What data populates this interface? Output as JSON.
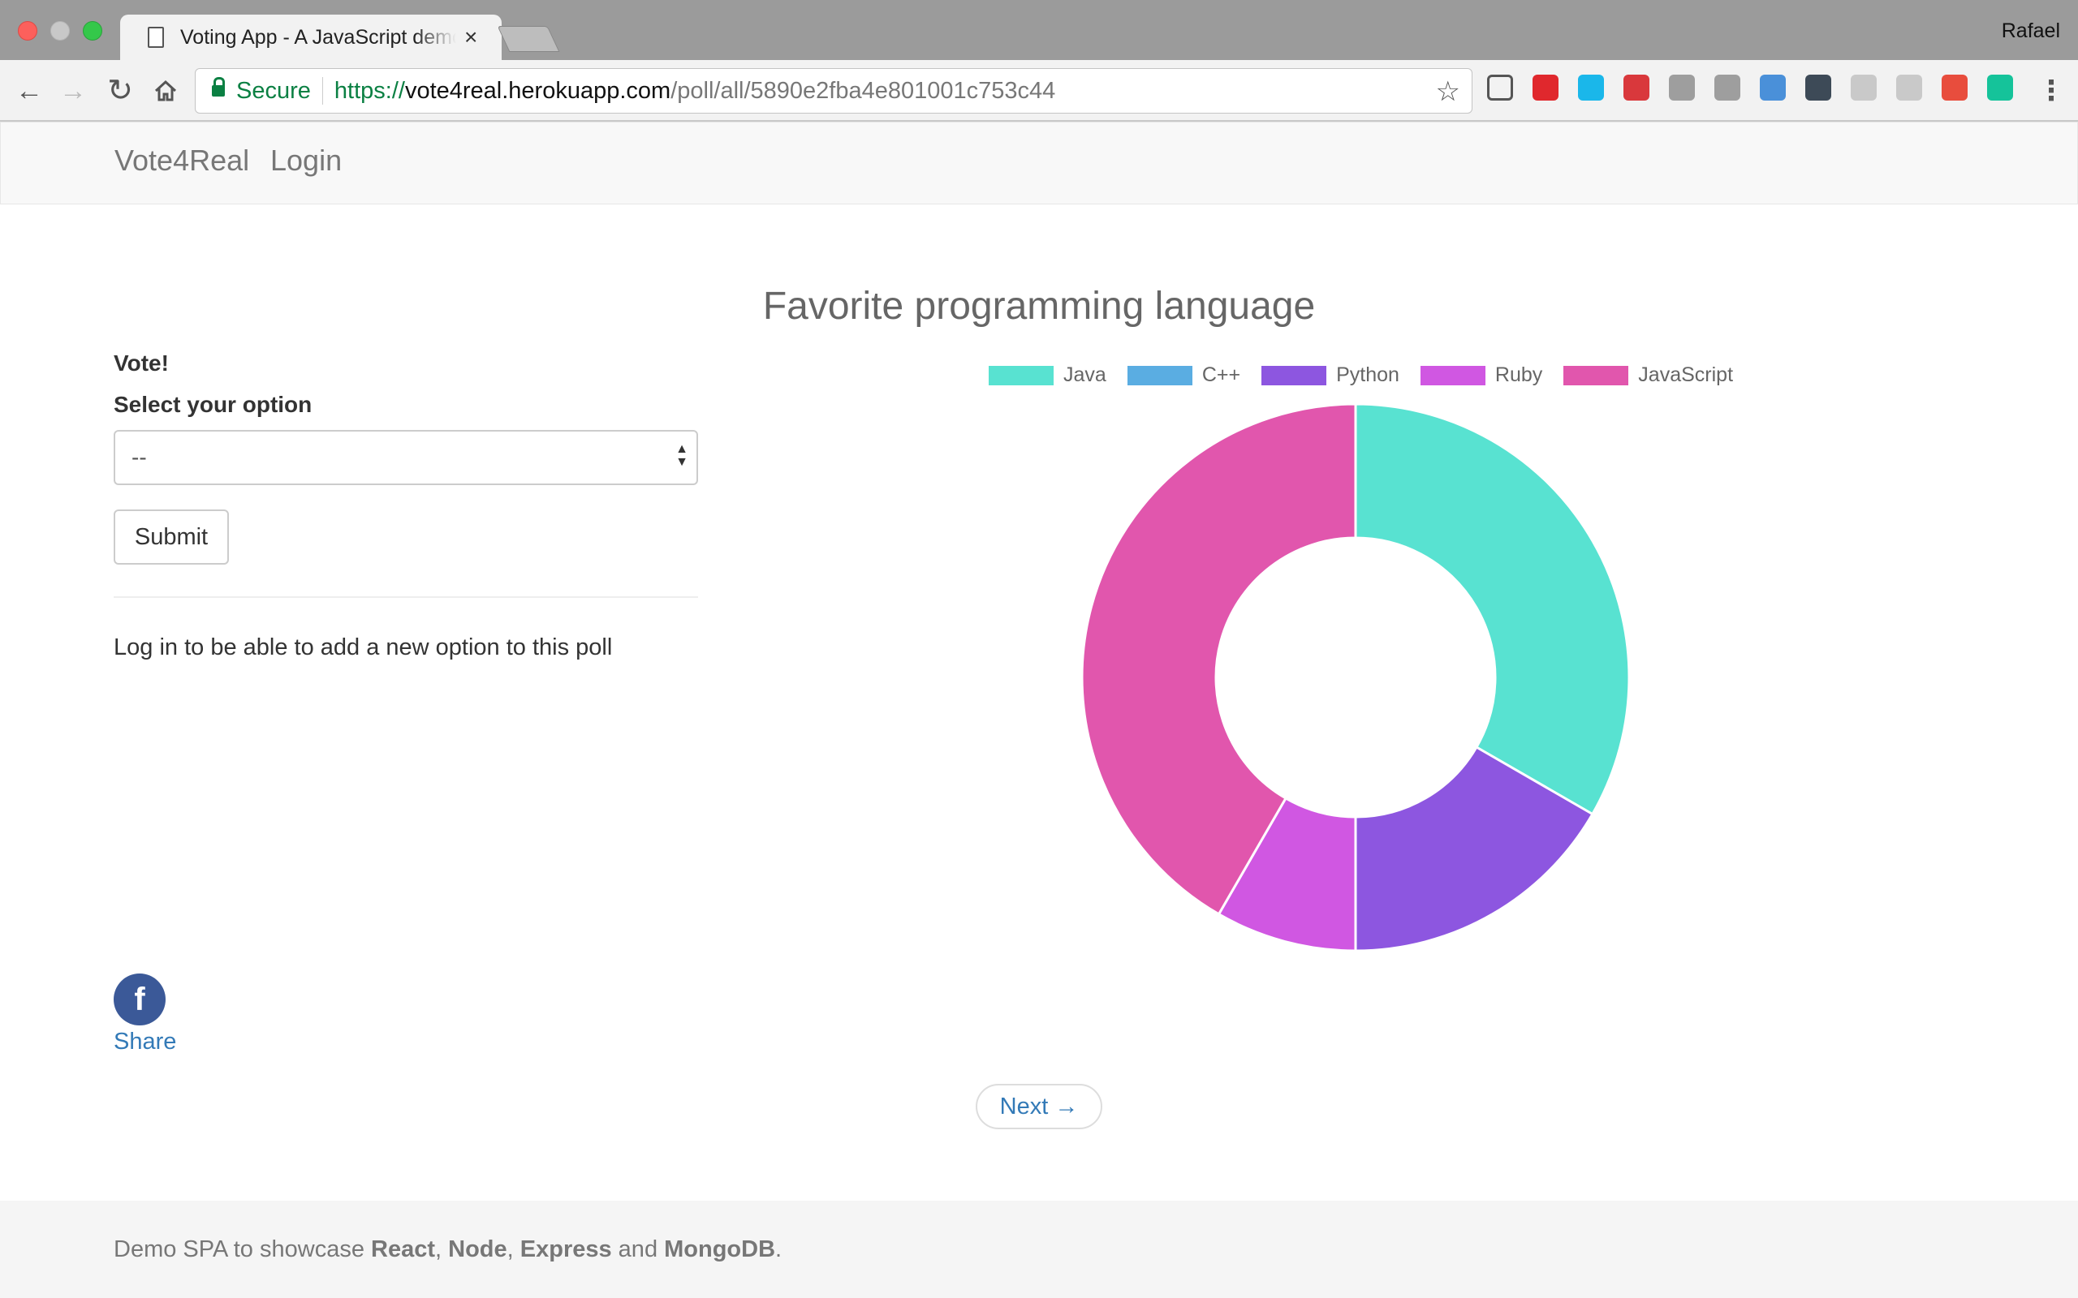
{
  "browser": {
    "tab_title": "Voting App - A JavaScript demo",
    "tab_close": "×",
    "profile_name": "Rafael",
    "secure_label": "Secure",
    "url_scheme": "https://",
    "url_host": "vote4real.herokuapp.com",
    "url_path": "/poll/all/5890e2fba4e801001c753c44",
    "extensions": [
      {
        "icon": "cast-icon",
        "color": "#ffffff"
      },
      {
        "icon": "opera-icon",
        "color": "#e0282d"
      },
      {
        "icon": "vimeo-icon",
        "color": "#1ab7ea"
      },
      {
        "icon": "plus-icon",
        "color": "#d9383c"
      },
      {
        "icon": "gif-icon",
        "color": "#9e9e9e"
      },
      {
        "icon": "drive-icon",
        "color": "#9e9e9e"
      },
      {
        "icon": "translate-icon",
        "color": "#4a90d9"
      },
      {
        "icon": "u-icon",
        "color": "#3d4a57"
      },
      {
        "icon": "doc-icon",
        "color": "#c9c9c9"
      },
      {
        "icon": "react-icon",
        "color": "#c9c9c9"
      },
      {
        "icon": "colorwheel-icon",
        "color": "#e84d3d"
      },
      {
        "icon": "grammarly-icon",
        "color": "#15c39a"
      }
    ]
  },
  "navbar": {
    "brand": "Vote4Real",
    "login": "Login"
  },
  "vote_form": {
    "title": "Vote!",
    "select_label": "Select your option",
    "select_value": "--",
    "submit_label": "Submit",
    "login_note": "Log in to be able to add a new option to this poll"
  },
  "share": {
    "fb_glyph": "f",
    "label": "Share"
  },
  "next_label": "Next →",
  "footer": {
    "prefix": "Demo SPA to showcase ",
    "t1": "React",
    "c1": ", ",
    "t2": "Node",
    "c2": ", ",
    "t3": "Express",
    "and": " and ",
    "t4": "MongoDB",
    "end": "."
  },
  "chart_data": {
    "type": "doughnut",
    "title": "Favorite programming language",
    "legend_position": "top",
    "labels": [
      "Java",
      "C++",
      "Python",
      "Ruby",
      "JavaScript"
    ],
    "values": [
      4,
      0,
      2,
      1,
      5
    ],
    "colors": [
      "#58e2d1",
      "#5aade2",
      "#8d56e0",
      "#d057e2",
      "#e156ad"
    ]
  }
}
